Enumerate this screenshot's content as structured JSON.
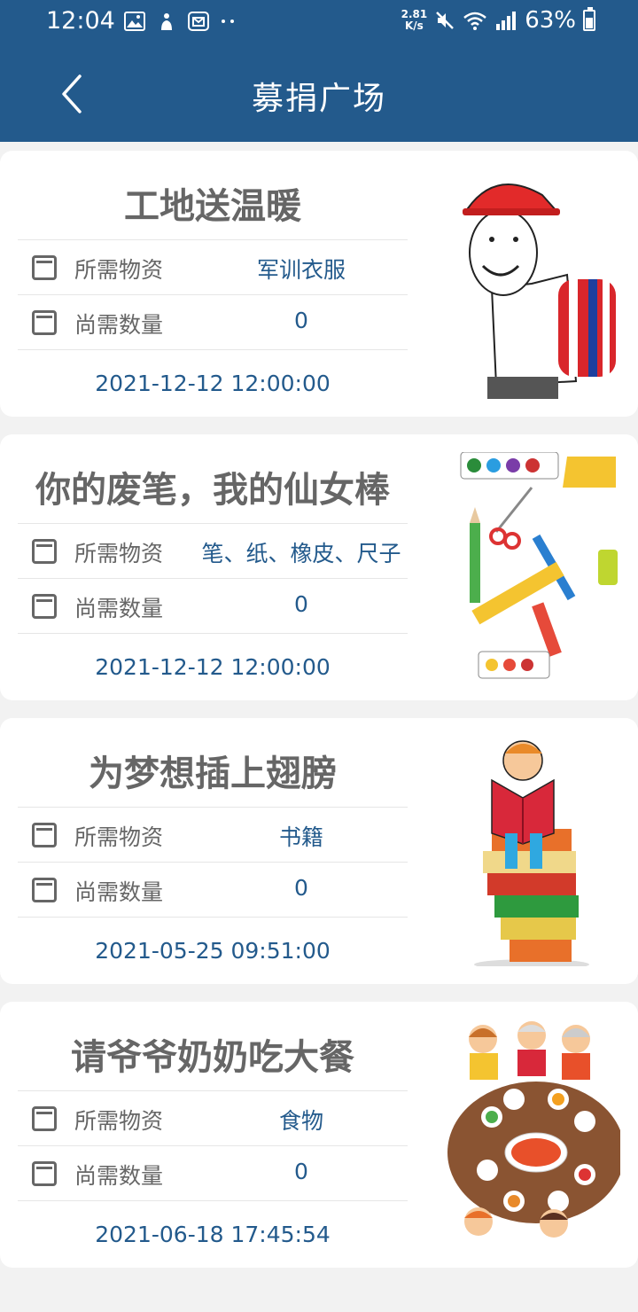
{
  "status_bar": {
    "time": "12:04",
    "net_speed_value": "2.81",
    "net_speed_unit": "K/s",
    "battery": "63%"
  },
  "header": {
    "title": "募捐广场"
  },
  "cards": [
    {
      "title": "工地送温暖",
      "material_label": "所需物资",
      "material_value": "军训衣服",
      "quantity_label": "尚需数量",
      "quantity_value": "0",
      "date": "2021-12-12 12:00:00",
      "image_icon": "construction-worker-image"
    },
    {
      "title": "你的废笔，我的仙女棒",
      "material_label": "所需物资",
      "material_value": "笔、纸、橡皮、尺子",
      "quantity_label": "尚需数量",
      "quantity_value": "0",
      "date": "2021-12-12 12:00:00",
      "image_icon": "stationery-image"
    },
    {
      "title": "为梦想插上翅膀",
      "material_label": "所需物资",
      "material_value": "书籍",
      "quantity_label": "尚需数量",
      "quantity_value": "0",
      "date": "2021-05-25 09:51:00",
      "image_icon": "boy-reading-on-books-image"
    },
    {
      "title": "请爷爷奶奶吃大餐",
      "material_label": "所需物资",
      "material_value": "食物",
      "quantity_label": "尚需数量",
      "quantity_value": "0",
      "date": "2021-06-18 17:45:54",
      "image_icon": "family-dinner-image"
    }
  ]
}
